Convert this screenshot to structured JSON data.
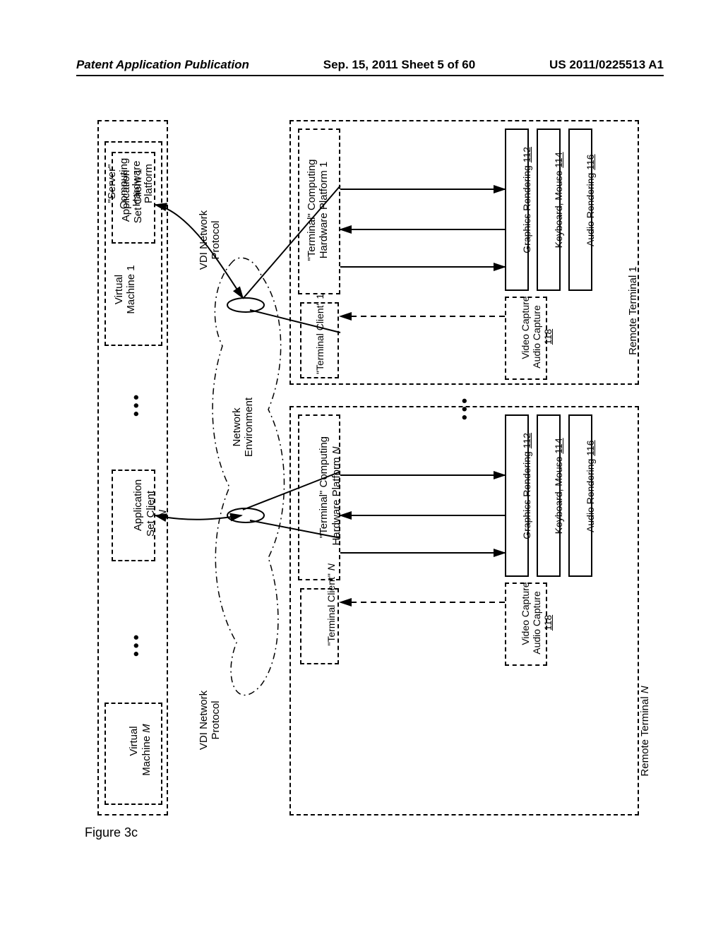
{
  "header": {
    "left": "Patent Application Publication",
    "center": "Sep. 15, 2011  Sheet 5 of 60",
    "right": "US 2011/0225513 A1"
  },
  "figure_label": "Figure 3c",
  "server": {
    "title": "\"Server\"\nComputing\nHardware\nPlatform",
    "vm1": "Virtual\nMachine 1",
    "app1": "Application\nSet Client 1",
    "appN_pre": "Application\nSet Client",
    "appN_suffix": "N",
    "vmM_pre": "Virtual\nMachine ",
    "vmM_suffix": "M"
  },
  "net": {
    "vdi": "VDI Network\nProtocol",
    "env": "Network\nEnvironment"
  },
  "terminal": {
    "hw1": "\"Terminal\" Computing\nHardware Platform 1",
    "client1": "\"Terminal Client\" 1",
    "hwN_pre": "\"Terminal\" Computing\nHardware Platform ",
    "hwN_suffix": "N",
    "clientN_pre": "\"Terminal Client\" ",
    "clientN_suffix": "N",
    "remote1": "Remote Terminal 1",
    "remoteN_pre": "Remote Terminal ",
    "remoteN_suffix": "N"
  },
  "modules": {
    "graphics_pre": "Graphics Rendering ",
    "graphics_ref": "112",
    "keyboard_pre": "Keyboard, Mouse ",
    "keyboard_ref": "114",
    "audio_pre": "Audio Rendering ",
    "audio_ref": "116",
    "capture_pre": "Video Capture\nAudio Capture",
    "capture_ref": "118"
  },
  "dots": "•••"
}
